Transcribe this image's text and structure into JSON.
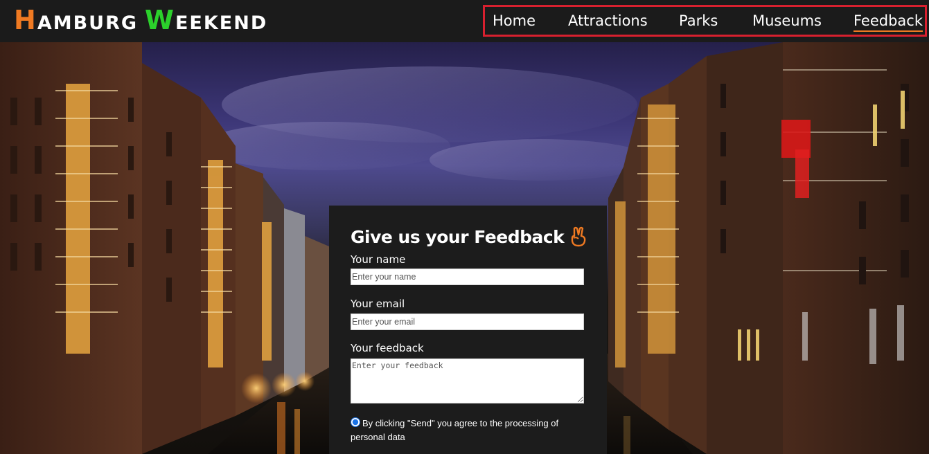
{
  "header": {
    "logo": {
      "word1_cap": "H",
      "word1_rest": "AMBURG",
      "word2_cap": "W",
      "word2_rest": "EEKEND",
      "word1_cap_color": "#f07a22",
      "word2_cap_color": "#2bd12b"
    },
    "nav": [
      {
        "label": "Home",
        "active": false
      },
      {
        "label": "Attractions",
        "active": false
      },
      {
        "label": "Parks",
        "active": false
      },
      {
        "label": "Museums",
        "active": false
      },
      {
        "label": "Feedback",
        "active": true
      }
    ],
    "nav_highlight_color": "#d8202f",
    "active_underline_color": "#f07a22"
  },
  "hero": {
    "icon": "hamburg-speicherstadt-canal-photo"
  },
  "feedback_form": {
    "title": "Give us your Feedback",
    "title_icon": "victory-hand-icon",
    "name": {
      "label": "Your name",
      "placeholder": "Enter your name",
      "value": ""
    },
    "email": {
      "label": "Your email",
      "placeholder": "Enter your email",
      "value": ""
    },
    "feedback": {
      "label": "Your feedback",
      "placeholder": "Enter your feedback",
      "value": ""
    },
    "consent": {
      "checked": true,
      "text": "By clicking \"Send\" you agree to the processing of personal data"
    },
    "accent_color": "#f07a22"
  }
}
